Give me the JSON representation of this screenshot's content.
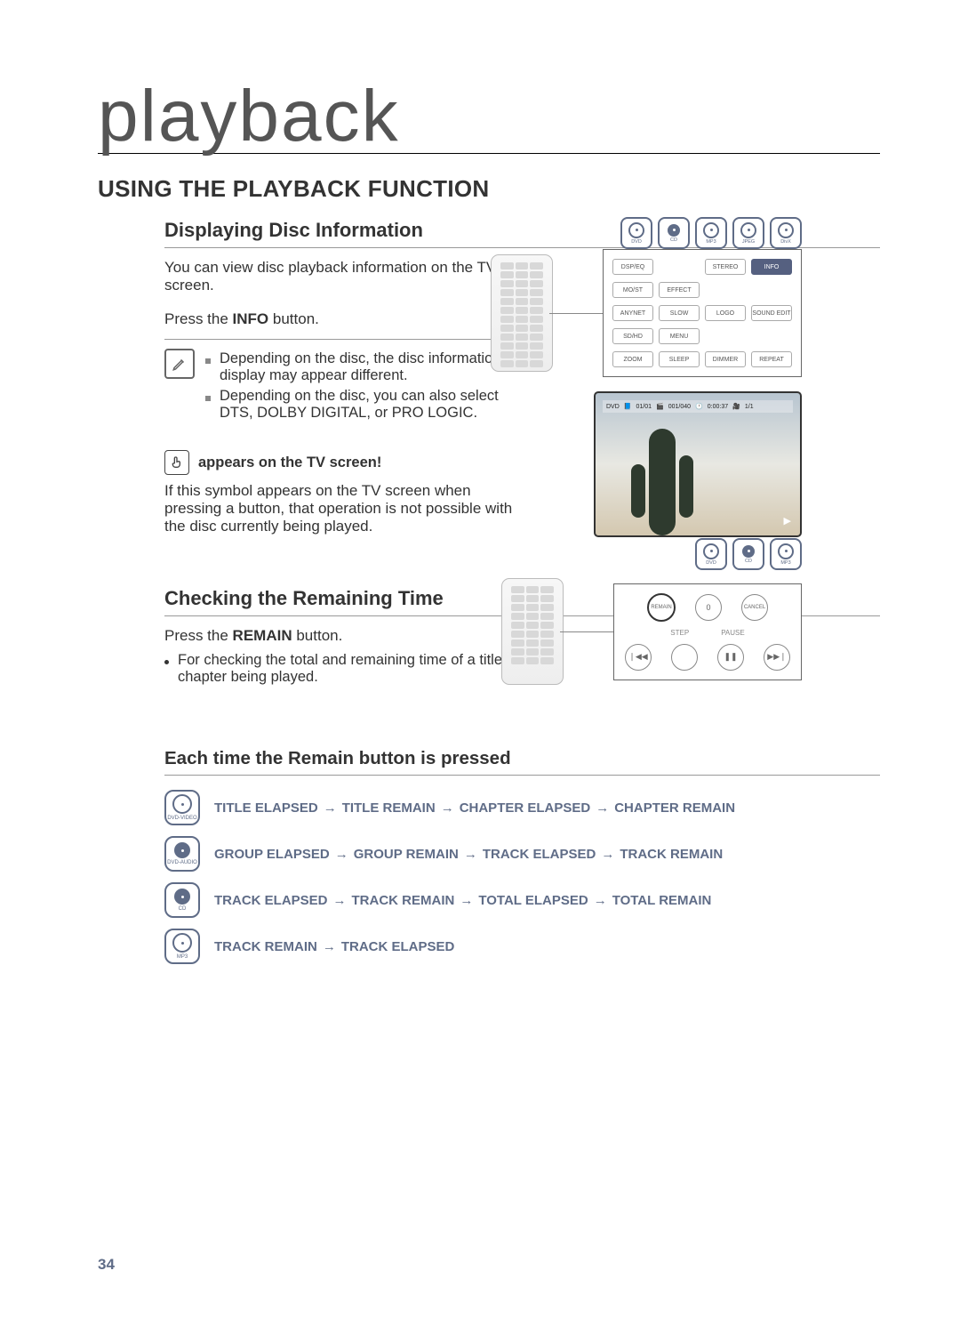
{
  "chapter_title": "playback",
  "section_heading": "USING THE PLAYBACK FUNCTION",
  "disc_info": {
    "heading": "Displaying Disc Information",
    "intro": "You can view disc playback information on the TV screen.",
    "instruction_pre": "Press the ",
    "instruction_btn": "INFO",
    "instruction_post": " button.",
    "note1": "Depending on the disc, the disc information display may appear different.",
    "note2": "Depending on the disc, you can also select DTS, DOLBY DIGITAL, or PRO LOGIC.",
    "hand_heading": "appears on the TV screen!",
    "hand_text": "If this symbol appears on the TV screen when pressing a button, that operation is not possible with the disc currently being played."
  },
  "badges_top": [
    "DVD",
    "CD",
    "MP3",
    "JPEG",
    "DivX"
  ],
  "info_panel": {
    "row1": [
      "DSP/EQ",
      "",
      "STEREO",
      "INFO"
    ],
    "row2": [
      "MO/ST",
      "EFFECT",
      "",
      ""
    ],
    "row3": [
      "ANYNET",
      "SLOW",
      "LOGO",
      "SOUND EDIT"
    ],
    "row4": [
      "SD/HD",
      "MENU",
      "",
      ""
    ],
    "row5": [
      "ZOOM",
      "SLEEP",
      "DIMMER",
      "REPEAT"
    ]
  },
  "tv_bar": {
    "dvd": "DVD",
    "title_no": "01/01",
    "chapter": "001/040",
    "time": "0:00:37",
    "lang": "1/1"
  },
  "remaining": {
    "heading": "Checking the Remaining Time",
    "instruction_pre": "Press the ",
    "instruction_btn": "REMAIN",
    "instruction_post": " button.",
    "bullet": "For checking the total and remaining time of a title or chapter being played."
  },
  "badges_remaining": [
    "DVD",
    "CD",
    "MP3"
  ],
  "remain_panel": {
    "btn_remain": "REMAIN",
    "btn_cancel": "CANCEL",
    "lbl_step": "STEP",
    "lbl_pause": "PAUSE"
  },
  "each_time_heading": "Each time the Remain button is pressed",
  "rows": [
    {
      "label": "DVD-VIDEO",
      "dark": false,
      "seq": [
        "TITLE ELAPSED",
        "TITLE REMAIN",
        "CHAPTER ELAPSED",
        "CHAPTER REMAIN"
      ]
    },
    {
      "label": "DVD-AUDIO",
      "dark": true,
      "seq": [
        "GROUP ELAPSED",
        "GROUP REMAIN",
        "TRACK ELAPSED",
        "TRACK REMAIN"
      ]
    },
    {
      "label": "CD",
      "dark": true,
      "seq": [
        "TRACK ELAPSED",
        "TRACK REMAIN",
        "TOTAL ELAPSED",
        "TOTAL REMAIN"
      ]
    },
    {
      "label": "MP3",
      "dark": false,
      "seq": [
        "TRACK REMAIN",
        "TRACK ELAPSED"
      ]
    }
  ],
  "page_number": "34",
  "icons": {
    "zero": "0",
    "prev": "❘◀◀",
    "pause": "❚❚",
    "next": "▶▶❘",
    "play": "▶"
  }
}
